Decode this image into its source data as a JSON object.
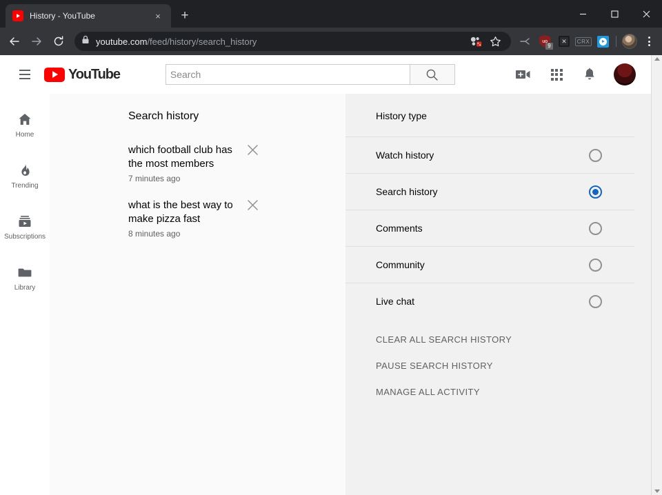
{
  "browser": {
    "tab": {
      "title": "History - YouTube",
      "favicon": "youtube-favicon",
      "close": "×"
    },
    "newtab_label": "+",
    "window_controls": {
      "minimize": "minimize-icon",
      "maximize": "maximize-icon",
      "close": "close-icon"
    },
    "nav": {
      "back": "back-arrow-icon",
      "forward": "forward-arrow-icon",
      "reload": "reload-icon"
    },
    "omnibox": {
      "lock": "lock-icon",
      "url_domain": "youtube.com",
      "url_path": "/feed/history/search_history"
    },
    "omnibox_icons": [
      {
        "name": "media-cast-icon",
        "label": ""
      },
      {
        "name": "bookmark-star-icon",
        "label": "☆"
      }
    ],
    "extensions": [
      {
        "name": "tab-tools-icon",
        "label": ""
      },
      {
        "name": "ublock-origin-icon",
        "label": "uo",
        "badge": "9"
      },
      {
        "name": "script-blocker-icon",
        "label": "✕"
      },
      {
        "name": "crx-extension-icon",
        "label": "CRX"
      },
      {
        "name": "video-downloader-icon",
        "label": ""
      }
    ],
    "profile": "profile-avatar",
    "menu": "chrome-menu-icon"
  },
  "youtube": {
    "menu_button": "hamburger-menu-icon",
    "logo_text": "YouTube",
    "search": {
      "placeholder": "Search",
      "value": "",
      "button": "search-icon"
    },
    "header_actions": [
      {
        "name": "create-video-icon"
      },
      {
        "name": "apps-grid-icon"
      },
      {
        "name": "notifications-bell-icon"
      },
      {
        "name": "account-avatar"
      }
    ],
    "guide": [
      {
        "label": "Home",
        "icon": "home-icon"
      },
      {
        "label": "Trending",
        "icon": "trending-flame-icon"
      },
      {
        "label": "Subscriptions",
        "icon": "subscriptions-icon"
      },
      {
        "label": "Library",
        "icon": "library-folder-icon"
      }
    ],
    "history": {
      "title": "Search history",
      "items": [
        {
          "query": "which football club has the most members",
          "time": "7 minutes ago",
          "remove": "✕"
        },
        {
          "query": "what is the best way to make pizza fast",
          "time": "8 minutes ago",
          "remove": "✕"
        }
      ]
    },
    "filters": {
      "title": "History type",
      "options": [
        {
          "label": "Watch history",
          "selected": false
        },
        {
          "label": "Search history",
          "selected": true
        },
        {
          "label": "Comments",
          "selected": false
        },
        {
          "label": "Community",
          "selected": false
        },
        {
          "label": "Live chat",
          "selected": false
        }
      ],
      "actions": [
        {
          "label": "CLEAR ALL SEARCH HISTORY"
        },
        {
          "label": "PAUSE SEARCH HISTORY"
        },
        {
          "label": "MANAGE ALL ACTIVITY"
        }
      ]
    },
    "colors": {
      "accent": "#1565c0",
      "brand": "#ff0000",
      "panel_bg": "#f1f1f1",
      "content_bg": "#fafafa"
    }
  }
}
